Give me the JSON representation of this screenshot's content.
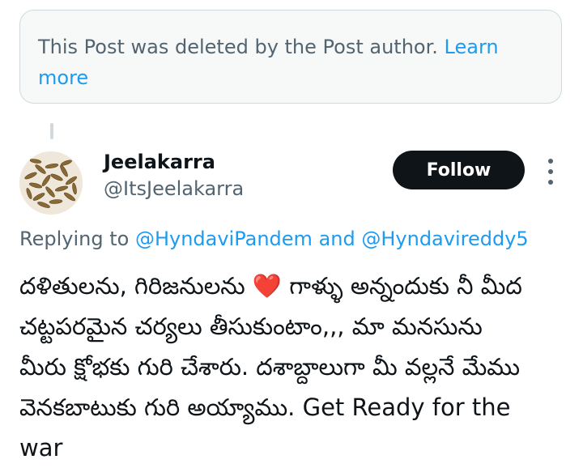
{
  "deleted_notice": {
    "text": "This Post was deleted by the Post author.",
    "link": "Learn more"
  },
  "tweet": {
    "display_name": "Jeelakarra",
    "handle": "@ItsJeelakarra",
    "follow_label": "Follow",
    "reply_prefix": "Replying to",
    "mention_1": "@HyndaviPandem",
    "reply_and": "and",
    "mention_2": "@Hyndavireddy5",
    "lines": [
      "దళితులను, గిరిజనులను ❤️ గాళ్ళు అన్నందుకు నీ మీద",
      "చట్టపరమైన చర్యలు తీసుకుంటాం,,, మా మనసును",
      "మీరు క్షోభకు గురి చేశారు. దశాబ్దాలుగా మీ వల్లనే మేము",
      "వెనకబాటుకు గురి అయ్యాము. Get Ready for the",
      "war"
    ]
  },
  "icons": {
    "avatar": "cumin-seeds-avatar",
    "more": "more-vertical-icon"
  },
  "colors": {
    "accent": "#1d9bf0",
    "text": "#0f1419",
    "muted": "#536471",
    "card_bg": "#f7f9f9",
    "border": "#cfd9de"
  }
}
